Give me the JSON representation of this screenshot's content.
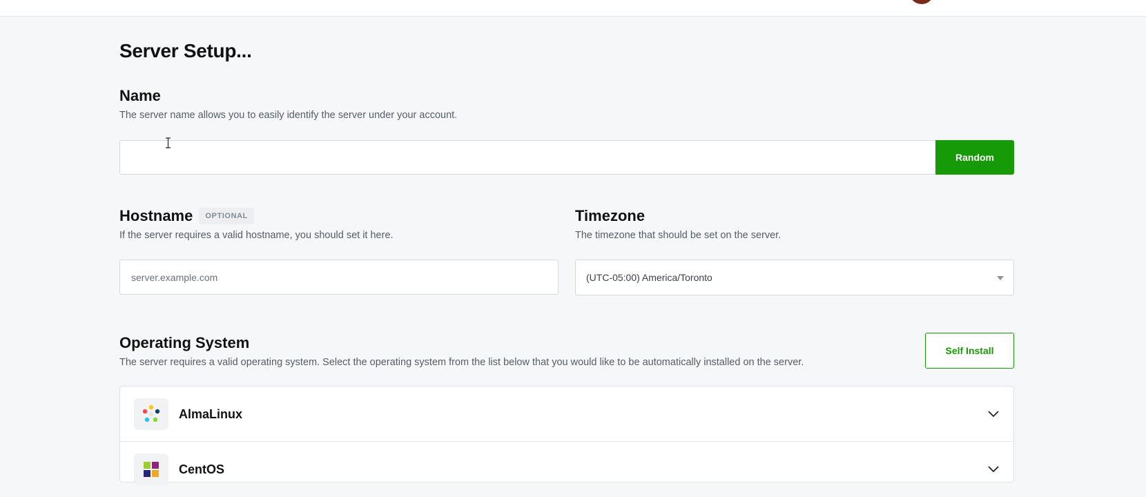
{
  "page": {
    "title": "Server Setup..."
  },
  "name_section": {
    "title": "Name",
    "description": "The server name allows you to easily identify the server under your account.",
    "input_value": "",
    "random_label": "Random"
  },
  "hostname_section": {
    "title": "Hostname",
    "badge": "OPTIONAL",
    "description": "If the server requires a valid hostname, you should set it here.",
    "placeholder": "server.example.com"
  },
  "timezone_section": {
    "title": "Timezone",
    "description": "The timezone that should be set on the server.",
    "selected": "(UTC-05:00) America/Toronto"
  },
  "os_section": {
    "title": "Operating System",
    "description": "The server requires a valid operating system. Select the operating system from the list below that you would like to be automatically installed on the server.",
    "self_install_label": "Self Install",
    "items": [
      {
        "name": "AlmaLinux",
        "icon": "almalinux-logo-icon"
      },
      {
        "name": "CentOS",
        "icon": "centos-logo-icon"
      }
    ]
  },
  "colors": {
    "accent_green": "#179a07",
    "background": "#f6f7f9",
    "avatar": "#7a2a1a"
  }
}
